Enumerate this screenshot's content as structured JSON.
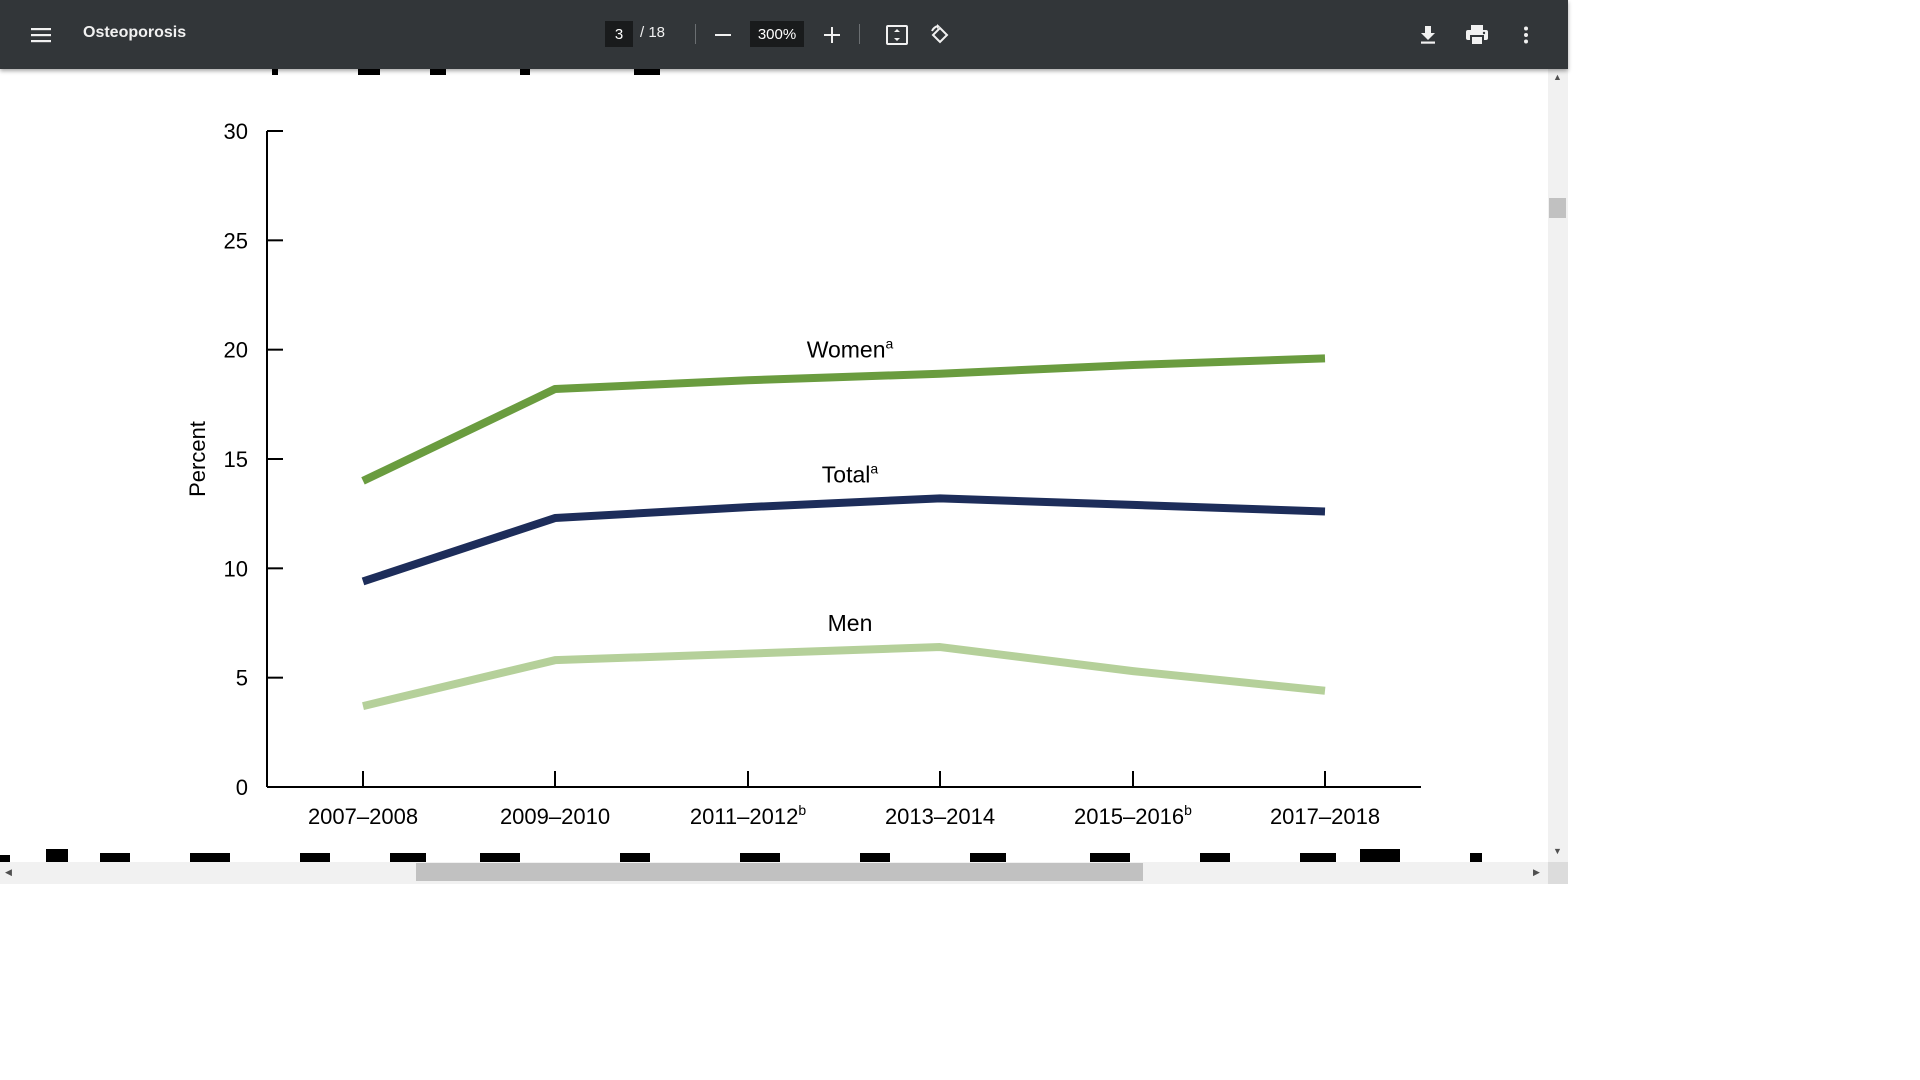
{
  "toolbar": {
    "title": "Osteoporosis",
    "current_page": "3",
    "total_pages": "/ 18",
    "zoom": "300%"
  },
  "icons": [
    "menu-icon",
    "zoom-out-icon",
    "zoom-in-icon",
    "fit-page-icon",
    "rotate-icon",
    "download-icon",
    "print-icon",
    "more-vert-icon"
  ],
  "chart_data": {
    "type": "line",
    "categories": [
      "2007–2008",
      "2009–2010",
      "2011–2012",
      "2013–2014",
      "2015–2016",
      "2017–2018"
    ],
    "category_superscripts": [
      "",
      "",
      "b",
      "",
      "b",
      ""
    ],
    "ylabel": "Percent",
    "ylim": [
      0,
      30
    ],
    "yticks": [
      0,
      5,
      10,
      15,
      20,
      25,
      30
    ],
    "grid": false,
    "series": [
      {
        "name": "Women",
        "superscript": "a",
        "color": "#6a9c3f",
        "values": [
          14.0,
          18.2,
          18.6,
          18.9,
          19.3,
          19.6
        ],
        "label_index": 3
      },
      {
        "name": "Total",
        "superscript": "a",
        "color": "#1d2d5a",
        "values": [
          9.4,
          12.3,
          12.8,
          13.2,
          12.9,
          12.6
        ],
        "label_index": 3
      },
      {
        "name": "Men",
        "superscript": "",
        "color": "#b5d09a",
        "values": [
          3.7,
          5.8,
          6.1,
          6.4,
          5.3,
          4.4
        ],
        "label_index": 3
      }
    ]
  }
}
